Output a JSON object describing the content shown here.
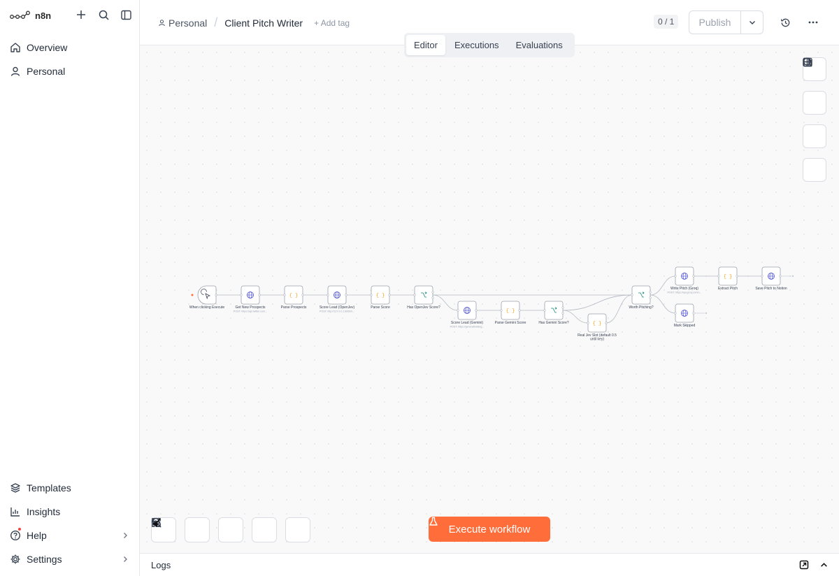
{
  "sidebar": {
    "logo_text": "n8n",
    "items": [
      {
        "label": "Overview",
        "icon": "house-icon"
      },
      {
        "label": "Personal",
        "icon": "user-icon"
      }
    ],
    "bottom_items": [
      {
        "label": "Templates",
        "icon": "layers-icon"
      },
      {
        "label": "Insights",
        "icon": "chart-icon"
      },
      {
        "label": "Help",
        "icon": "help-icon"
      },
      {
        "label": "Settings",
        "icon": "gear-icon"
      }
    ]
  },
  "header": {
    "owner": "Personal",
    "workflow_name": "Client Pitch Writer",
    "add_tag": "+ Add tag",
    "counter": "0 / 1",
    "publish_label": "Publish"
  },
  "tabs": [
    {
      "label": "Editor",
      "active": true
    },
    {
      "label": "Executions",
      "active": false
    },
    {
      "label": "Evaluations",
      "active": false
    }
  ],
  "execute_label": "Execute workflow",
  "logs_label": "Logs",
  "colors": {
    "accent": "#ff6d3a",
    "http_icon": "#4b4fd6",
    "code_icon": "#f59e0b",
    "if_icon": "#14857a"
  },
  "nodes": [
    {
      "name": "When clicking Execute",
      "type": "trigger",
      "subtitle": ""
    },
    {
      "name": "Get New Prospects",
      "type": "http",
      "subtitle": "POST: https://api.twitter.com..."
    },
    {
      "name": "Parse Prospects",
      "type": "code",
      "subtitle": ""
    },
    {
      "name": "Score Lead (OpenJev)",
      "type": "http",
      "subtitle": "POST: http://127.0.0.1:8000/v..."
    },
    {
      "name": "Parse Score",
      "type": "code",
      "subtitle": ""
    },
    {
      "name": "Has OpenJev Score?",
      "type": "if",
      "subtitle": ""
    },
    {
      "name": "Score Lead (Gemini)",
      "type": "http",
      "subtitle": "POST: https://generativelang..."
    },
    {
      "name": "Parse Gemini Score",
      "type": "code",
      "subtitle": ""
    },
    {
      "name": "Has Gemini Score?",
      "type": "if",
      "subtitle": ""
    },
    {
      "name": "Real Jev Slot (default 0.5 until key)",
      "type": "code",
      "subtitle": ""
    },
    {
      "name": "Worth Pitching?",
      "type": "if",
      "subtitle": ""
    },
    {
      "name": "Write Pitch (Groq)",
      "type": "http",
      "subtitle": "POST: https://api.groq.com/o..."
    },
    {
      "name": "Extract Pitch",
      "type": "code",
      "subtitle": ""
    },
    {
      "name": "Save Pitch to Notion",
      "type": "http",
      "subtitle": ""
    },
    {
      "name": "Mark Skipped",
      "type": "http",
      "subtitle": ""
    }
  ]
}
